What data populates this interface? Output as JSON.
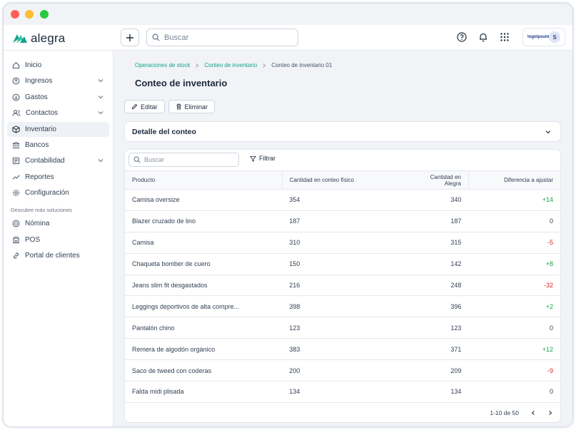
{
  "app": {
    "logo_text": "alegra",
    "account_logo": "logoipsum",
    "avatar_initial": "S"
  },
  "topbar": {
    "search_placeholder": "Buscar"
  },
  "sidebar": {
    "items": [
      {
        "label": "Inicio",
        "icon": "home-icon"
      },
      {
        "label": "Ingresos",
        "icon": "income-icon",
        "expandable": true
      },
      {
        "label": "Gastos",
        "icon": "expense-icon",
        "expandable": true
      },
      {
        "label": "Contactos",
        "icon": "contacts-icon",
        "expandable": true
      },
      {
        "label": "Inventario",
        "icon": "box-icon",
        "active": true
      },
      {
        "label": "Bancos",
        "icon": "bank-icon"
      },
      {
        "label": "Contabilidad",
        "icon": "accounting-icon",
        "expandable": true
      },
      {
        "label": "Reportes",
        "icon": "chart-line-icon"
      },
      {
        "label": "Configuración",
        "icon": "gear-icon"
      }
    ],
    "section_label": "Descubre más soluciones",
    "extra_items": [
      {
        "label": "Nómina",
        "icon": "payroll-icon"
      },
      {
        "label": "POS",
        "icon": "pos-icon"
      },
      {
        "label": "Portal de clientes",
        "icon": "link-icon"
      }
    ]
  },
  "breadcrumb": {
    "items": [
      "Operaciones de stock",
      "Conteo de inventario"
    ],
    "current": "Conteo de inventario 01"
  },
  "page": {
    "title": "Conteo de inventario",
    "edit_label": "Editar",
    "delete_label": "Eliminar",
    "detail_title": "Detalle del conteo"
  },
  "table": {
    "search_placeholder": "Buscar",
    "filter_label": "Filtrar",
    "columns": [
      "Producto",
      "Cantidad en conteo físico",
      "Cantidad en Alegra",
      "Diferencia a ajustar"
    ],
    "rows": [
      {
        "product": "Camisa oversize",
        "physical": "354",
        "alegra": "340",
        "diff": "+14",
        "kind": "pos"
      },
      {
        "product": "Blazer cruzado de lino",
        "physical": "187",
        "alegra": "187",
        "diff": "0",
        "kind": "zero"
      },
      {
        "product": "Camisa",
        "physical": "310",
        "alegra": "315",
        "diff": "-5",
        "kind": "neg"
      },
      {
        "product": "Chaqueta bomber de cuero",
        "physical": "150",
        "alegra": "142",
        "diff": "+8",
        "kind": "pos"
      },
      {
        "product": "Jeans slim fit desgastados",
        "physical": "216",
        "alegra": "248",
        "diff": "-32",
        "kind": "neg"
      },
      {
        "product": "Leggings deportivos de alta compre...",
        "physical": "398",
        "alegra": "396",
        "diff": "+2",
        "kind": "pos"
      },
      {
        "product": "Pantalón chino",
        "physical": "123",
        "alegra": "123",
        "diff": "0",
        "kind": "zero"
      },
      {
        "product": "Remera de algodón orgánico",
        "physical": "383",
        "alegra": "371",
        "diff": "+12",
        "kind": "pos"
      },
      {
        "product": "Saco de tweed con coderas",
        "physical": "200",
        "alegra": "209",
        "diff": "-9",
        "kind": "neg"
      },
      {
        "product": "Falda midi plisada",
        "physical": "134",
        "alegra": "134",
        "diff": "0",
        "kind": "zero"
      }
    ],
    "pagination": "1-10 de 50"
  },
  "colors": {
    "brand": "#14a38b",
    "positive": "#16a34a",
    "negative": "#dc2626"
  }
}
